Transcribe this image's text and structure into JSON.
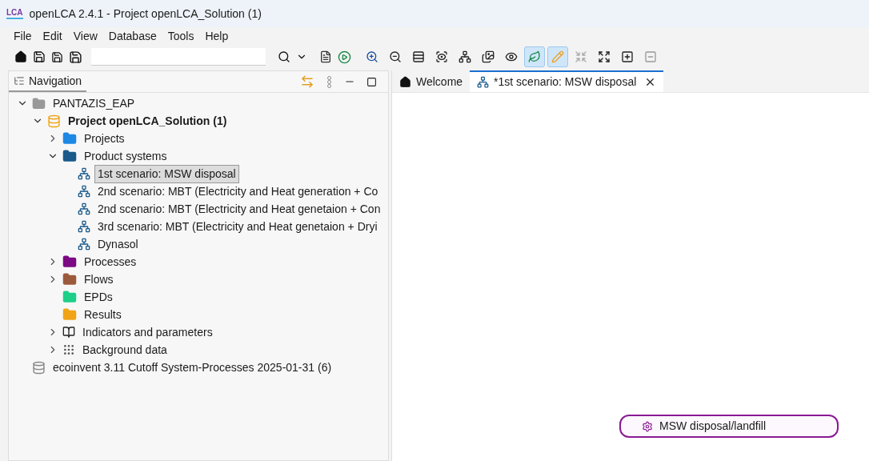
{
  "window": {
    "logo": "LCA",
    "title": "openLCA 2.4.1 - Project openLCA_Solution (1)"
  },
  "menu": [
    "File",
    "Edit",
    "View",
    "Database",
    "Tools",
    "Help"
  ],
  "navigation": {
    "title": "Navigation",
    "tree": [
      {
        "label": "PANTAZIS_EAP",
        "kind": "server",
        "expanded": true,
        "selected": false,
        "children": [
          {
            "label": "Project openLCA_Solution (1)",
            "kind": "database",
            "bold": true,
            "expanded": true,
            "selected": false,
            "children": [
              {
                "label": "Projects",
                "kind": "folder",
                "color": "#1e88e5",
                "expanded": false,
                "selected": false
              },
              {
                "label": "Product systems",
                "kind": "folder",
                "color": "#1a5a8a",
                "expanded": true,
                "selected": false,
                "children": [
                  {
                    "label": "1st scenario: MSW disposal",
                    "kind": "system",
                    "selected": true
                  },
                  {
                    "label": "2nd scenario: MBT (Electricity and Heat generation + Co",
                    "kind": "system",
                    "selected": false
                  },
                  {
                    "label": "2nd scenario: MBT (Electricity and Heat genetaion + Con",
                    "kind": "system",
                    "selected": false
                  },
                  {
                    "label": "3rd scenario: MBT (Electricity and Heat genetaion + Dryi",
                    "kind": "system",
                    "selected": false
                  },
                  {
                    "label": "Dynasol",
                    "kind": "system",
                    "selected": false
                  }
                ]
              },
              {
                "label": "Processes",
                "kind": "folder",
                "color": "#7b0a84",
                "expanded": false,
                "selected": false
              },
              {
                "label": "Flows",
                "kind": "folder",
                "color": "#9c5a3c",
                "expanded": false,
                "selected": false
              },
              {
                "label": "EPDs",
                "kind": "folder",
                "color": "#1ecf8a",
                "selected": false
              },
              {
                "label": "Results",
                "kind": "folder",
                "color": "#f0a416",
                "selected": false
              },
              {
                "label": "Indicators and parameters",
                "kind": "indicators",
                "expanded": false,
                "selected": false
              },
              {
                "label": "Background data",
                "kind": "background",
                "expanded": false,
                "selected": false
              }
            ]
          }
        ]
      },
      {
        "label": "ecoinvent 3.11 Cutoff System-Processes 2025-01-31 (6)",
        "kind": "database-grey",
        "selected": false
      }
    ]
  },
  "editor": {
    "graph_toolbar": [
      {
        "kind": "zoom-in",
        "on": false
      },
      {
        "kind": "zoom-out",
        "on": false
      },
      {
        "kind": "layout",
        "on": false
      },
      {
        "kind": "focus",
        "on": false
      },
      {
        "kind": "tree",
        "on": false
      },
      {
        "kind": "images",
        "on": false
      },
      {
        "kind": "eye",
        "on": false
      },
      {
        "kind": "leaf",
        "on": true
      },
      {
        "kind": "pencil",
        "on": true
      },
      {
        "kind": "collapse",
        "on": false
      },
      {
        "kind": "expand",
        "on": false
      },
      {
        "kind": "plus",
        "on": false
      },
      {
        "kind": "minus",
        "on": false
      }
    ],
    "tabs": [
      {
        "label": "Welcome",
        "kind": "home",
        "selected": false,
        "closable": false
      },
      {
        "label": "*1st scenario: MSW disposal",
        "kind": "system",
        "selected": true,
        "closable": true
      }
    ],
    "nodes": [
      {
        "label": "MSW disposal/landfill"
      }
    ]
  }
}
